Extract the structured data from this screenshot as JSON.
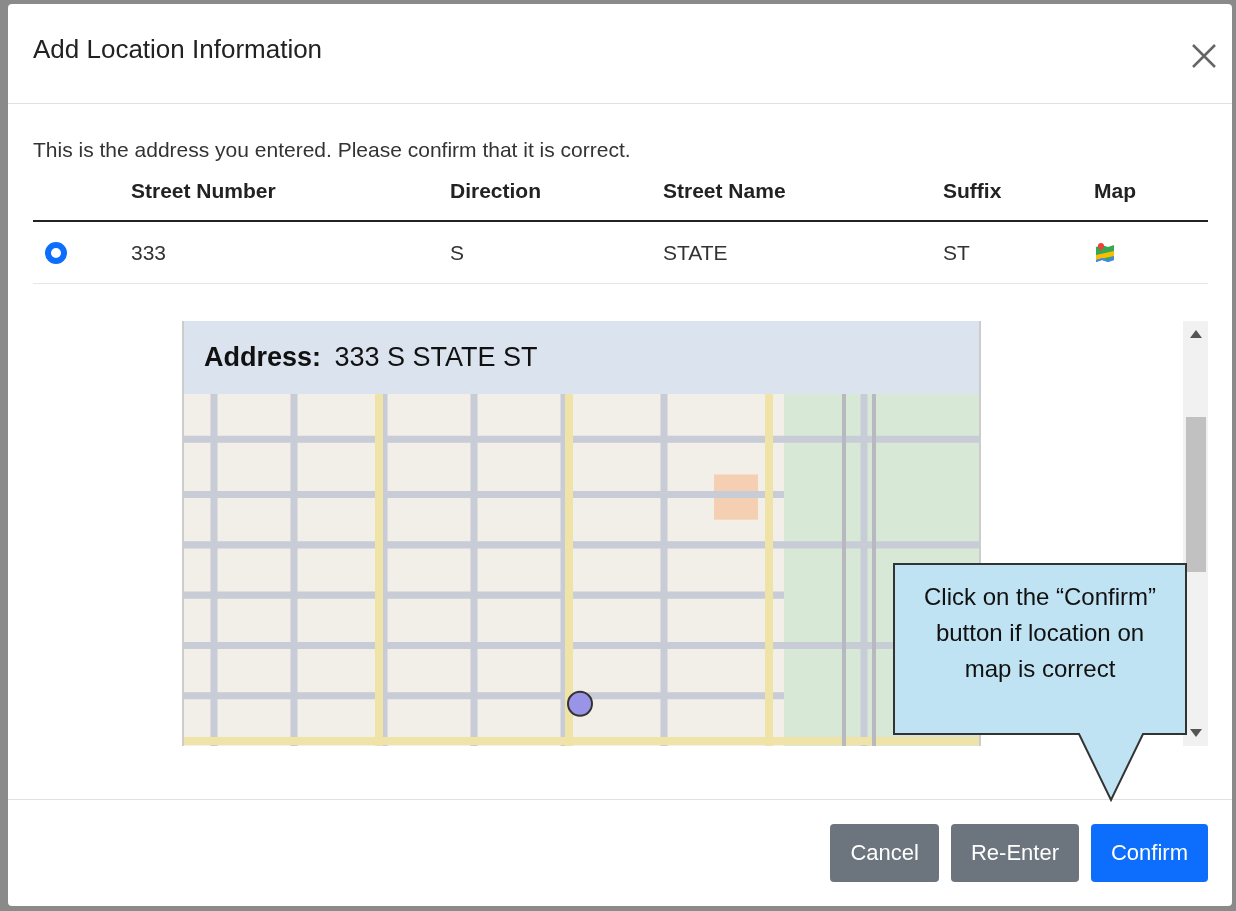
{
  "dialog": {
    "title": "Add Location Information"
  },
  "message": "This is the address you entered. Please confirm that it is correct.",
  "table": {
    "columns": [
      "Street Number",
      "Direction",
      "Street Name",
      "Suffix",
      "Map"
    ],
    "rows": [
      {
        "selected": true,
        "cells": [
          "333",
          "S",
          "STATE",
          "ST"
        ]
      }
    ]
  },
  "map_panel": {
    "label": "Address:",
    "address": "333 S STATE ST"
  },
  "callout": {
    "text": "Click on the “Confirm” button if location on map is correct"
  },
  "buttons": [
    {
      "label": "Cancel",
      "kind": "secondary"
    },
    {
      "label": "Re-Enter",
      "kind": "secondary"
    },
    {
      "label": "Confirm",
      "kind": "primary"
    }
  ]
}
